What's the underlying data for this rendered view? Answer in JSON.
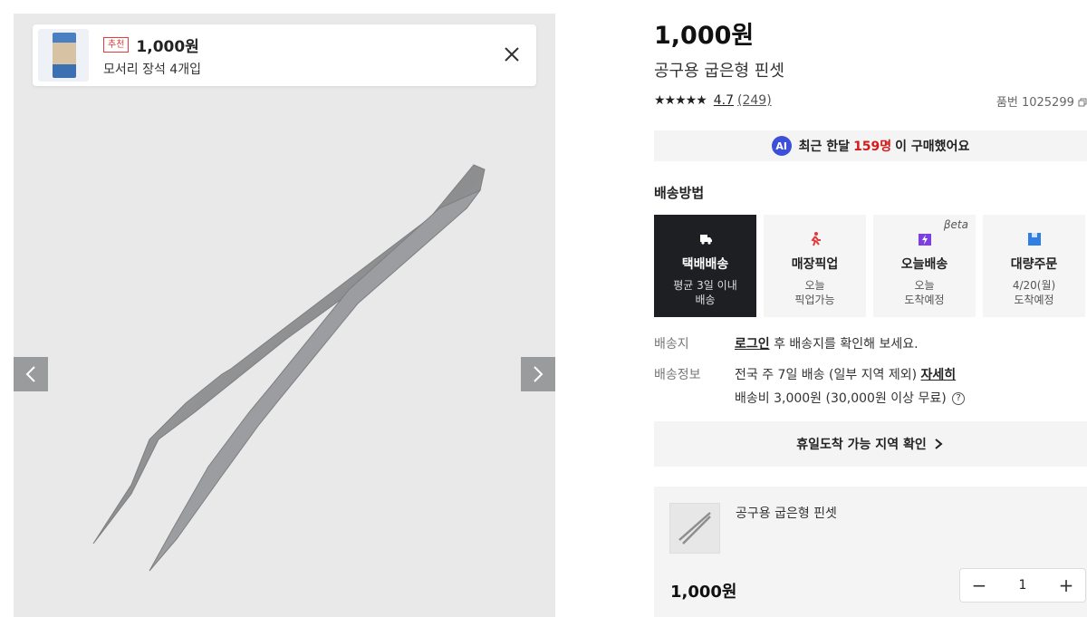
{
  "recommend": {
    "badge": "추천",
    "price": "1,000원",
    "name": "모서리 장석 4개입"
  },
  "product": {
    "price": "1,000원",
    "title": "공구용 굽은형 핀셋",
    "stars": "★★★★★",
    "rating": "4.7",
    "review_count": "(249)",
    "part_number": "품번 1025299"
  },
  "ai_bar": {
    "icon": "AI",
    "prefix": "최근 한달",
    "count": "159명",
    "suffix": "이 구매했어요"
  },
  "shipping": {
    "title": "배송방법",
    "options": [
      {
        "name": "택배배송",
        "desc1": "평균 3일 이내",
        "desc2": "배송",
        "icon": "truck-icon",
        "active": true
      },
      {
        "name": "매장픽업",
        "desc1": "오늘",
        "desc2": "픽업가능",
        "icon": "walking-person-icon"
      },
      {
        "name": "오늘배송",
        "desc1": "오늘",
        "desc2": "도착예정",
        "icon": "lightning-box-icon",
        "beta": "βeta"
      },
      {
        "name": "대량주문",
        "desc1": "4/20(월)",
        "desc2": "도착예정",
        "icon": "bulk-box-icon"
      }
    ],
    "dest_label": "배송지",
    "dest_link": "로그인",
    "dest_text": " 후 배송지를 확인해 보세요.",
    "info_label": "배송정보",
    "info_text": "전국 주 7일 배송 (일부 지역 제외)",
    "info_link": "자세히",
    "fee_text": "배송비 3,000원 (30,000원 이상 무료)",
    "help": "?"
  },
  "holiday_button": "휴일도착 가능 지역 확인",
  "cart": {
    "name": "공구용 굽은형 핀셋",
    "price": "1,000원",
    "quantity": "1",
    "minus": "−",
    "plus": "+"
  },
  "colors": {
    "accent_red": "#d51a1a",
    "ai_blue": "#3b4fd8",
    "active_dark": "#1e1f23"
  }
}
